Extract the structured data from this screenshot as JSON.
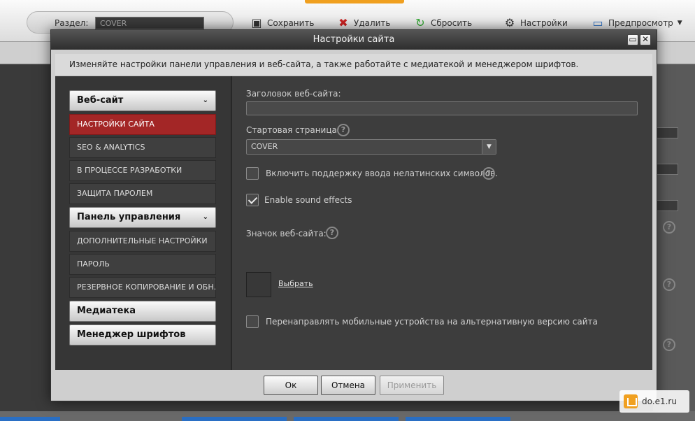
{
  "background": {
    "section_label": "Раздел:",
    "section_value": "COVER",
    "toolbar": [
      {
        "label": "Сохранить",
        "icon": "save-icon"
      },
      {
        "label": "Удалить",
        "icon": "delete-icon"
      },
      {
        "label": "Сбросить",
        "icon": "reset-icon"
      },
      {
        "label": "Настройки",
        "icon": "gear-icon"
      },
      {
        "label": "Предпросмотр",
        "icon": "preview-icon"
      }
    ],
    "watermark": "do.e1.ru"
  },
  "dialog": {
    "title": "Настройки сайта",
    "description": "Изменяйте настройки панели управления и веб-сайта, а также работайте с медиатекой и менеджером шрифтов.",
    "sidebar": {
      "groups": [
        {
          "label": "Веб-сайт",
          "expanded": true,
          "items": [
            {
              "label": "НАСТРОЙКИ САЙТА",
              "active": true
            },
            {
              "label": "SEO & ANALYTICS",
              "active": false
            },
            {
              "label": "В ПРОЦЕССЕ РАЗРАБОТКИ",
              "active": false
            },
            {
              "label": "ЗАЩИТА ПАРОЛЕМ",
              "active": false
            }
          ]
        },
        {
          "label": "Панель управления",
          "expanded": true,
          "items": [
            {
              "label": "ДОПОЛНИТЕЛЬНЫЕ НАСТРОЙКИ",
              "active": false
            },
            {
              "label": "ПАРОЛЬ",
              "active": false
            },
            {
              "label": "РЕЗЕРВНОЕ КОПИРОВАНИЕ И ОБН...",
              "active": false
            }
          ]
        },
        {
          "label": "Медиатека",
          "expanded": false,
          "items": []
        },
        {
          "label": "Менеджер шрифтов",
          "expanded": false,
          "items": []
        }
      ]
    },
    "form": {
      "site_title_label": "Заголовок веб-сайта:",
      "site_title_value": "",
      "start_page_label": "Стартовая страница:",
      "start_page_value": "COVER",
      "non_latin_label": "Включить поддержку ввода нелатинских символов.",
      "non_latin_checked": false,
      "sound_label": "Enable sound effects",
      "sound_checked": true,
      "favicon_label": "Значок веб-сайта:",
      "favicon_choose": "Выбрать",
      "mobile_redirect_label": "Перенаправлять мобильные устройства на альтернативную версию сайта",
      "mobile_redirect_checked": false
    },
    "buttons": {
      "ok": "Ок",
      "cancel": "Отмена",
      "apply": "Применить"
    }
  },
  "colors": {
    "active_item": "#a32626",
    "panel_dark": "#3d3d3d",
    "sidebar_dark": "#363636"
  }
}
